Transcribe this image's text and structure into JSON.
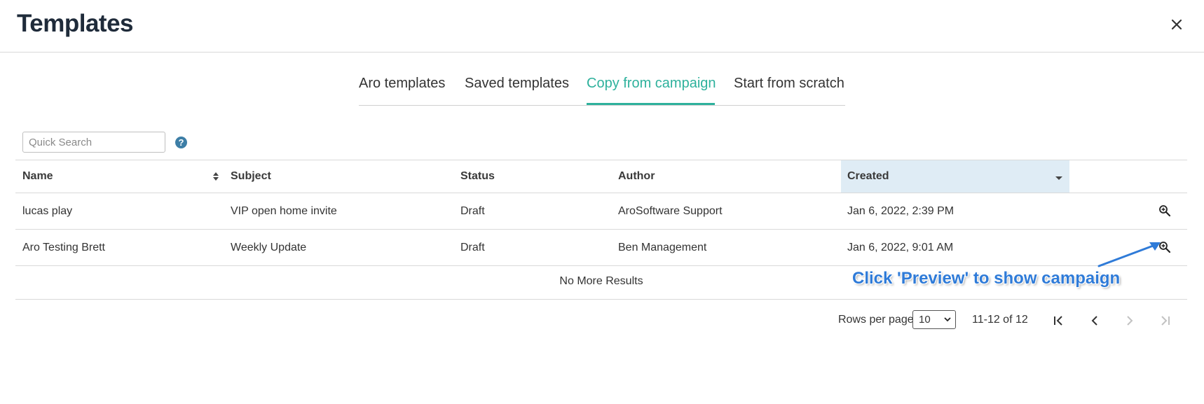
{
  "header": {
    "title": "Templates",
    "close_icon": "close-icon"
  },
  "tabs": [
    {
      "label": "Aro templates",
      "active": false
    },
    {
      "label": "Saved templates",
      "active": false
    },
    {
      "label": "Copy from campaign",
      "active": true
    },
    {
      "label": "Start from scratch",
      "active": false
    }
  ],
  "search": {
    "placeholder": "Quick Search",
    "value": "",
    "help_icon": "question-circle-icon",
    "help_symbol": "?"
  },
  "table": {
    "columns": [
      "Name",
      "Subject",
      "Status",
      "Author",
      "Created"
    ],
    "sorted_column": "Created",
    "rows": [
      {
        "name": "lucas play",
        "subject": "VIP open home invite",
        "status": "Draft",
        "author": "AroSoftware Support",
        "created": "Jan 6, 2022, 2:39 PM"
      },
      {
        "name": "Aro Testing Brett",
        "subject": "Weekly Update",
        "status": "Draft",
        "author": "Ben Management",
        "created": "Jan 6, 2022, 9:01 AM"
      }
    ],
    "end_message": "No More Results"
  },
  "annotation": {
    "text": "Click 'Preview' to show campaign"
  },
  "pagination": {
    "rows_per_page_label": "Rows per page",
    "rows_per_page_value": "10",
    "range_text": "11-12 of 12"
  },
  "colors": {
    "accent": "#2eb19c",
    "sorted_header_bg": "#dfecf5",
    "annotation": "#2f7bd8",
    "help": "#3d7ea6"
  }
}
